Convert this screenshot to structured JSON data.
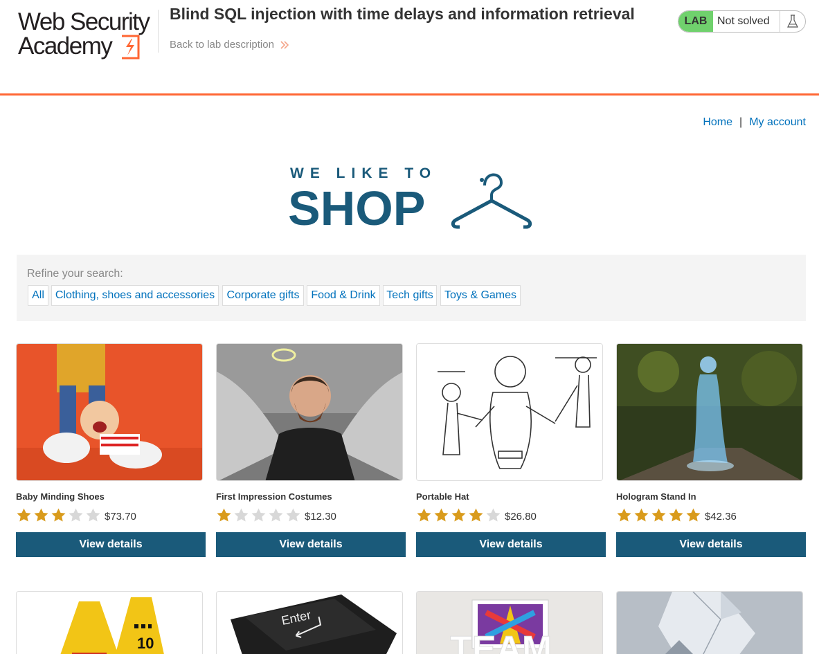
{
  "academy": {
    "logo_line1": "Web Security",
    "logo_line2": "Academy",
    "lab_title": "Blind SQL injection with time delays and information retrieval",
    "back_link": "Back to lab description",
    "lab_badge": "LAB",
    "lab_status": "Not solved"
  },
  "nav": {
    "home": "Home",
    "separator": "|",
    "my_account": "My account"
  },
  "banner": {
    "line1": "WE LIKE TO",
    "line2": "SHOP"
  },
  "filters": {
    "label": "Refine your search:",
    "categories": [
      "All",
      "Clothing, shoes and accessories",
      "Corporate gifts",
      "Food & Drink",
      "Tech gifts",
      "Toys & Games"
    ]
  },
  "products": [
    {
      "name": "Baby Minding Shoes",
      "rating": 3,
      "price": "$73.70",
      "button": "View details"
    },
    {
      "name": "First Impression Costumes",
      "rating": 1,
      "price": "$12.30",
      "button": "View details"
    },
    {
      "name": "Portable Hat",
      "rating": 4,
      "price": "$26.80",
      "button": "View details"
    },
    {
      "name": "Hologram Stand In",
      "rating": 5,
      "price": "$42.36",
      "button": "View details"
    }
  ],
  "row2_images": [
    "caution-signs-image",
    "enter-key-image",
    "team-sign-image",
    "origami-image"
  ],
  "colors": {
    "accent_orange": "#ff6633",
    "lab_green": "#70d16d",
    "brand_blue": "#1a5a7a",
    "link_blue": "#0071bc",
    "star_gold": "#d99b1c"
  }
}
